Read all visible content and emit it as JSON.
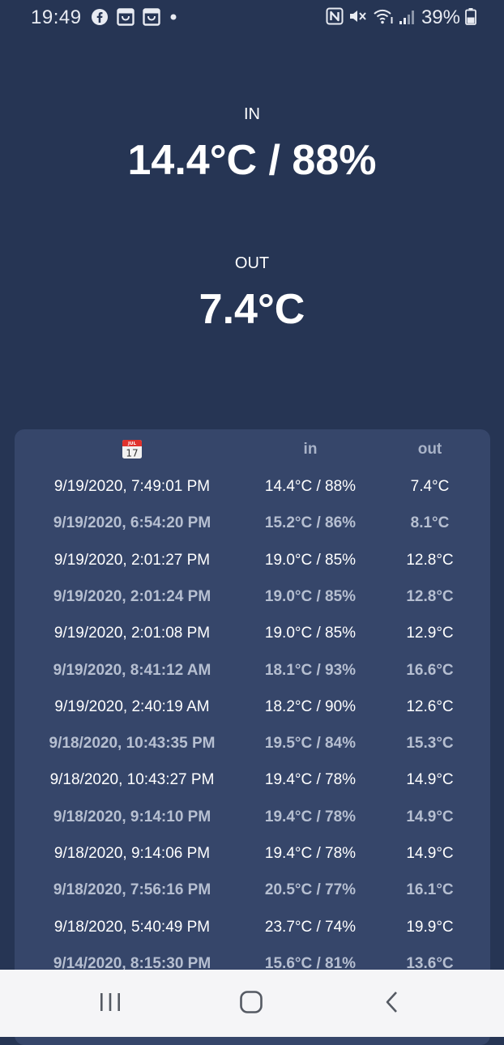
{
  "status_bar": {
    "time": "19:49",
    "battery": "39%",
    "left_icons": [
      "facebook-icon",
      "shopping-bag-icon",
      "shopping-bag-icon",
      "notification-dot-icon"
    ],
    "right_icons": [
      "nfc-icon",
      "mute-icon",
      "wifi-icon",
      "signal-icon",
      "battery-icon"
    ]
  },
  "current": {
    "in_label": "IN",
    "in_value": "14.4°C / 88%",
    "out_label": "OUT",
    "out_value": "7.4°C"
  },
  "history": {
    "header": {
      "date_icon": "calendar-icon",
      "calendar_day": "17",
      "calendar_month": "JUL",
      "in": "in",
      "out": "out"
    },
    "rows": [
      {
        "date": "9/19/2020, 7:49:01 PM",
        "in": "14.4°C / 88%",
        "out": "7.4°C"
      },
      {
        "date": "9/19/2020, 6:54:20 PM",
        "in": "15.2°C / 86%",
        "out": "8.1°C"
      },
      {
        "date": "9/19/2020, 2:01:27 PM",
        "in": "19.0°C / 85%",
        "out": "12.8°C"
      },
      {
        "date": "9/19/2020, 2:01:24 PM",
        "in": "19.0°C / 85%",
        "out": "12.8°C"
      },
      {
        "date": "9/19/2020, 2:01:08 PM",
        "in": "19.0°C / 85%",
        "out": "12.9°C"
      },
      {
        "date": "9/19/2020, 8:41:12 AM",
        "in": "18.1°C / 93%",
        "out": "16.6°C"
      },
      {
        "date": "9/19/2020, 2:40:19 AM",
        "in": "18.2°C / 90%",
        "out": "12.6°C"
      },
      {
        "date": "9/18/2020, 10:43:35 PM",
        "in": "19.5°C / 84%",
        "out": "15.3°C"
      },
      {
        "date": "9/18/2020, 10:43:27 PM",
        "in": "19.4°C / 78%",
        "out": "14.9°C"
      },
      {
        "date": "9/18/2020, 9:14:10 PM",
        "in": "19.4°C / 78%",
        "out": "14.9°C"
      },
      {
        "date": "9/18/2020, 9:14:06 PM",
        "in": "19.4°C / 78%",
        "out": "14.9°C"
      },
      {
        "date": "9/18/2020, 7:56:16 PM",
        "in": "20.5°C / 77%",
        "out": "16.1°C"
      },
      {
        "date": "9/18/2020, 5:40:49 PM",
        "in": "23.7°C / 74%",
        "out": "19.9°C"
      },
      {
        "date": "9/14/2020, 8:15:30 PM",
        "in": "15.6°C / 81%",
        "out": "13.6°C"
      }
    ]
  },
  "nav_bar": {
    "buttons": [
      "recent-apps-icon",
      "home-icon",
      "back-icon"
    ]
  },
  "colors": {
    "background": "#263554",
    "card": "#36466a",
    "text_primary": "#ffffff",
    "text_secondary": "#b6bfd1",
    "nav_bar": "#f5f5f7"
  }
}
